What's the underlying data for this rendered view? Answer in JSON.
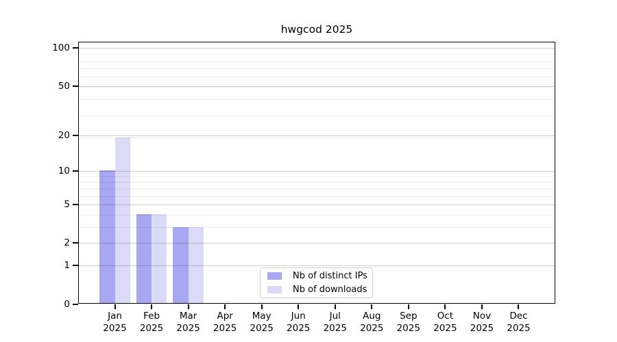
{
  "title": "hwgcod 2025",
  "year": "2025",
  "months": [
    "Jan",
    "Feb",
    "Mar",
    "Apr",
    "May",
    "Jun",
    "Jul",
    "Aug",
    "Sep",
    "Oct",
    "Nov",
    "Dec"
  ],
  "y_tick_labels": [
    "100",
    "50",
    "20",
    "10",
    "5",
    "2",
    "1",
    "0"
  ],
  "legend": {
    "items": [
      {
        "label": "Nb of distinct IPs",
        "color": "#a7a7f2"
      },
      {
        "label": "Nb of downloads",
        "color": "#dbdbf8"
      }
    ]
  },
  "colors": {
    "distinct_ips_bar": "#a7a7f2",
    "downloads_bar": "#dbdbf8",
    "spine": "#000000",
    "grid_major": "#cccccc",
    "grid_minor": "#ededed",
    "background": "#ffffff"
  },
  "chart_data": {
    "type": "bar",
    "title": "hwgcod 2025",
    "categories": [
      "Jan 2025",
      "Feb 2025",
      "Mar 2025",
      "Apr 2025",
      "May 2025",
      "Jun 2025",
      "Jul 2025",
      "Aug 2025",
      "Sep 2025",
      "Oct 2025",
      "Nov 2025",
      "Dec 2025"
    ],
    "series": [
      {
        "name": "Nb of distinct IPs",
        "color": "#a7a7f2",
        "values": [
          10,
          4,
          3,
          0,
          0,
          0,
          0,
          0,
          0,
          0,
          0,
          0
        ]
      },
      {
        "name": "Nb of downloads",
        "color": "#dbdbf8",
        "values": [
          19,
          4,
          3,
          0,
          0,
          0,
          0,
          0,
          0,
          0,
          0,
          0
        ]
      }
    ],
    "y_ticks": [
      100,
      50,
      20,
      10,
      5,
      2,
      1,
      0
    ],
    "y_scale": "log10(value+1)",
    "ylim": [
      0,
      112
    ],
    "grid": "horizontal",
    "legend_position": "lower center"
  }
}
